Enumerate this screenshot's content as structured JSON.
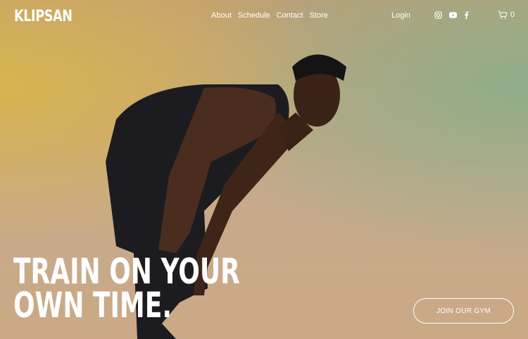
{
  "header": {
    "logo": "KLIPSAN",
    "nav": [
      "About",
      "Schedule",
      "Contact",
      "Store"
    ],
    "login": "Login",
    "cart_count": "0",
    "social": [
      "instagram-icon",
      "youtube-icon",
      "facebook-icon"
    ]
  },
  "hero": {
    "headline_line1": "TRAIN ON YOUR",
    "headline_line2": "OWN TIME.",
    "cta": "JOIN OUR GYM"
  }
}
